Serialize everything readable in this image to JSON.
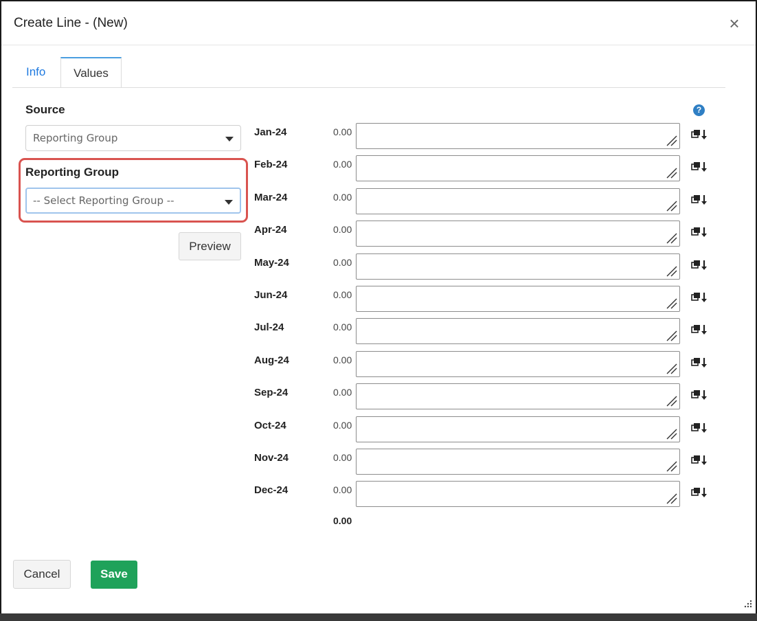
{
  "dialog": {
    "title": "Create Line - (New)",
    "close_symbol": "×"
  },
  "tabs": [
    {
      "label": "Info",
      "active": false
    },
    {
      "label": "Values",
      "active": true
    }
  ],
  "source": {
    "label": "Source",
    "selected": "Reporting Group"
  },
  "reporting_group": {
    "label": "Reporting Group",
    "placeholder": "-- Select Reporting Group --",
    "highlight_color": "#d9534f"
  },
  "preview_button": "Preview",
  "help_icon": "?",
  "months": [
    {
      "label": "Jan-24",
      "value": "0.00"
    },
    {
      "label": "Feb-24",
      "value": "0.00"
    },
    {
      "label": "Mar-24",
      "value": "0.00"
    },
    {
      "label": "Apr-24",
      "value": "0.00"
    },
    {
      "label": "May-24",
      "value": "0.00"
    },
    {
      "label": "Jun-24",
      "value": "0.00"
    },
    {
      "label": "Jul-24",
      "value": "0.00"
    },
    {
      "label": "Aug-24",
      "value": "0.00"
    },
    {
      "label": "Sep-24",
      "value": "0.00"
    },
    {
      "label": "Oct-24",
      "value": "0.00"
    },
    {
      "label": "Nov-24",
      "value": "0.00"
    },
    {
      "label": "Dec-24",
      "value": "0.00"
    }
  ],
  "total": "0.00",
  "footer": {
    "cancel_label": "Cancel",
    "save_label": "Save"
  },
  "colors": {
    "tab_link": "#1f7ae0",
    "save_button": "#1fa25a",
    "help_icon": "#2f7fc4"
  }
}
